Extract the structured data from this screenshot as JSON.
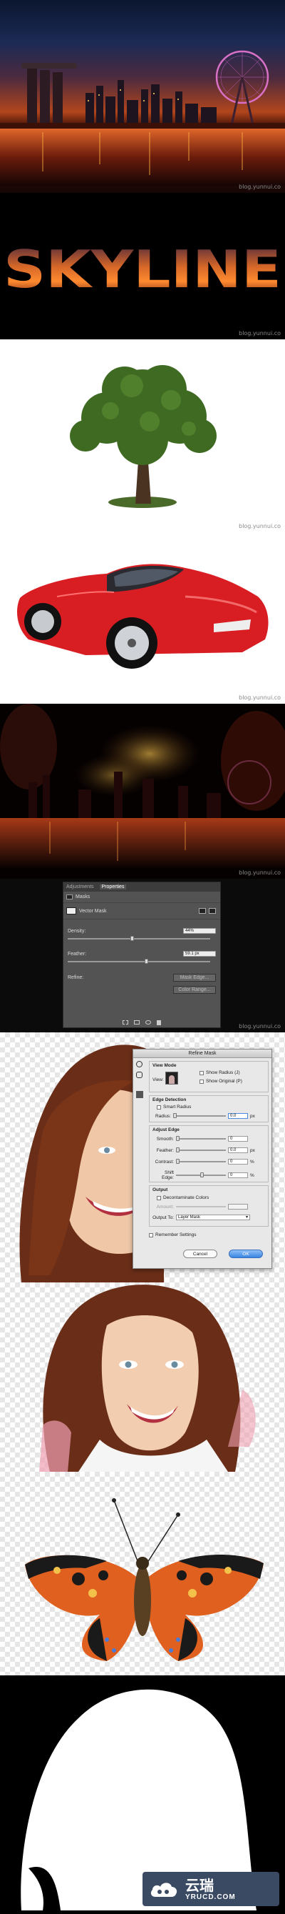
{
  "watermark": "blog.yunnui.co",
  "skyline": {
    "text": "SKYLINE"
  },
  "properties_panel": {
    "tab_adjustments": "Adjustments",
    "tab_properties": "Properties",
    "section_masks": "Masks",
    "vector_mask_label": "Vector Mask",
    "density_label": "Density:",
    "density_value": "44%",
    "feather_label": "Feather:",
    "feather_value": "59.1 px",
    "refine_label": "Refine:",
    "mask_edge_button": "Mask Edge...",
    "color_range_button": "Color Range..."
  },
  "refine_mask": {
    "title": "Refine Mask",
    "view_mode_header": "View Mode",
    "view_label": "View:",
    "show_radius": "Show Radius (J)",
    "show_original": "Show Original (P)",
    "edge_detection_header": "Edge Detection",
    "smart_radius": "Smart Radius",
    "radius_label": "Radius:",
    "radius_value": "0.0",
    "radius_unit": "px",
    "adjust_edge_header": "Adjust Edge",
    "smooth_label": "Smooth:",
    "smooth_value": "0",
    "feather_label": "Feather:",
    "feather_value": "0.0",
    "feather_unit": "px",
    "contrast_label": "Contrast:",
    "contrast_value": "0",
    "contrast_unit": "%",
    "shift_edge_label": "Shift Edge:",
    "shift_edge_value": "0",
    "shift_edge_unit": "%",
    "output_header": "Output",
    "decontaminate_label": "Decontaminate Colors",
    "amount_label": "Amount:",
    "output_to_label": "Output To:",
    "output_to_value": "Layer Mask",
    "remember_label": "Remember Settings",
    "cancel_button": "Cancel",
    "ok_button": "OK"
  },
  "logo": {
    "cn": "云瑞",
    "en": "YRUCD.COM"
  }
}
